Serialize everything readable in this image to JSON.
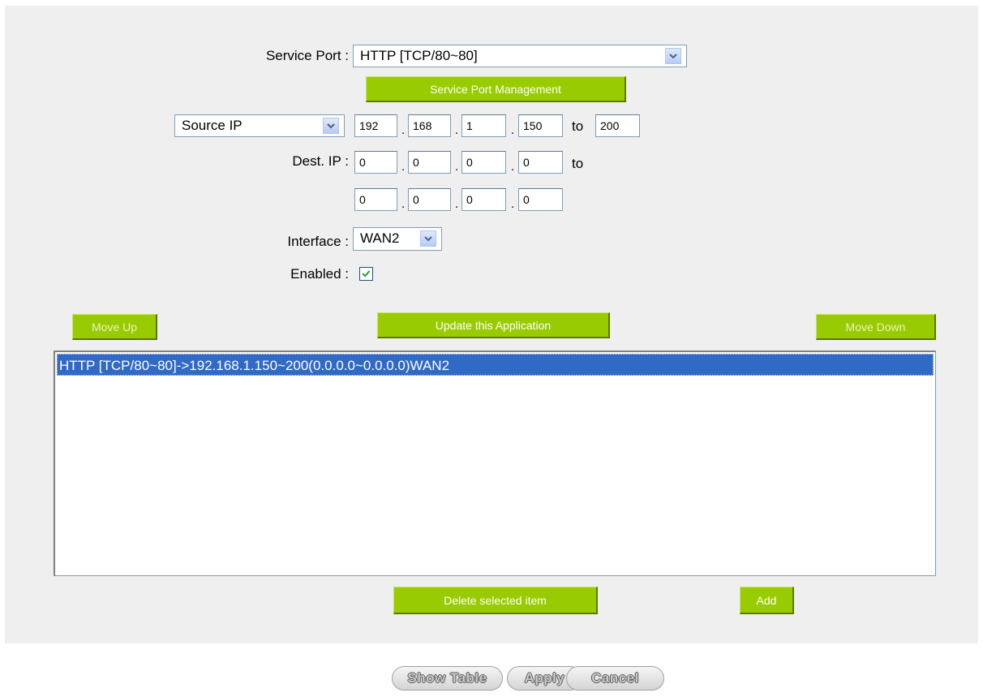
{
  "form": {
    "service_port_label": "Service Port :",
    "service_port_value": "HTTP [TCP/80~80]",
    "service_port_mgmt_label": "Service Port Management",
    "source_type_value": "Source IP",
    "source_ip": [
      "192",
      "168",
      "1",
      "150"
    ],
    "source_ip_to": "200",
    "to_text": "to",
    "dest_ip_label": "Dest. IP :",
    "dest_ip_start": [
      "0",
      "0",
      "0",
      "0"
    ],
    "dest_ip_end": [
      "0",
      "0",
      "0",
      "0"
    ],
    "interface_label": "Interface :",
    "interface_value": "WAN2",
    "enabled_label": "Enabled :",
    "enabled_checked": true,
    "dot": "."
  },
  "actions": {
    "move_up": "Move Up",
    "update": "Update this Application",
    "move_down": "Move Down",
    "delete_selected": "Delete selected item",
    "add": "Add"
  },
  "rule_list": {
    "items": [
      "HTTP [TCP/80~80]->192.168.1.150~200(0.0.0.0~0.0.0.0)WAN2"
    ],
    "selected_index": 0
  },
  "footer": {
    "show_table": "Show Table",
    "apply": "Apply",
    "cancel": "Cancel"
  },
  "colors": {
    "panel_bg": "#efefef",
    "green_button": "#99cc00",
    "selection": "#316ac5"
  }
}
